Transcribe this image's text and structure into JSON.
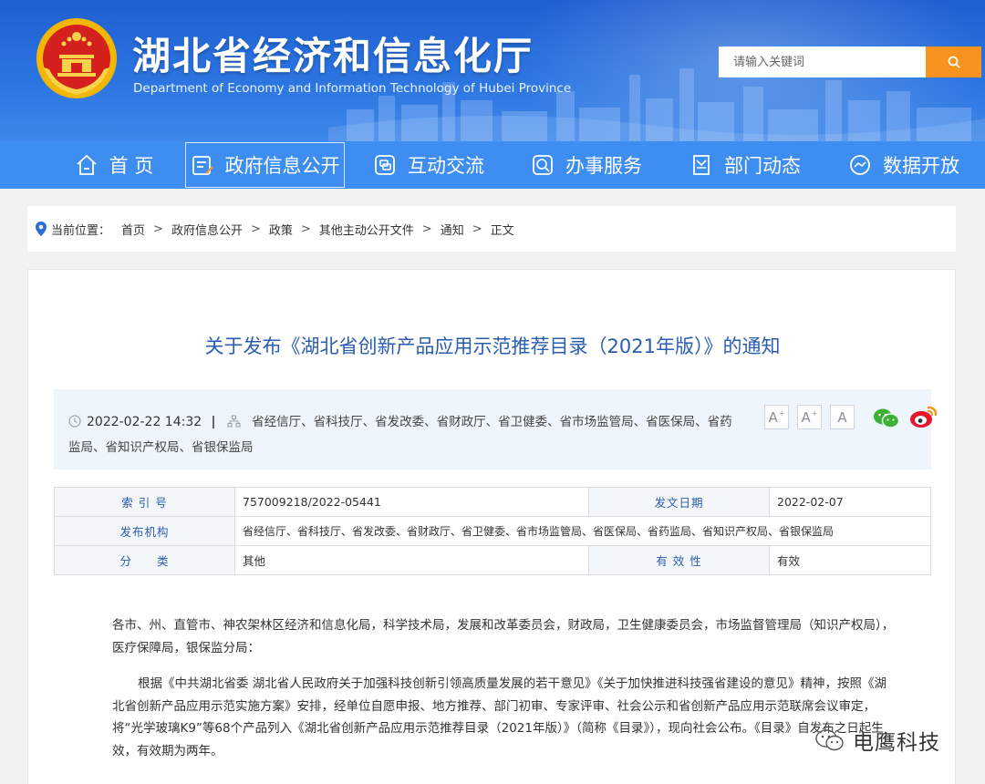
{
  "header": {
    "title": "湖北省经济和信息化厅",
    "subtitle": "Department of Economy and Information Technology of Hubei Province",
    "search_placeholder": "请输入关键词"
  },
  "nav": {
    "items": [
      {
        "label": "首 页",
        "icon": "home-icon"
      },
      {
        "label": "政府信息公开",
        "icon": "document-icon",
        "active": true
      },
      {
        "label": "互动交流",
        "icon": "interaction-icon"
      },
      {
        "label": "办事服务",
        "icon": "service-icon"
      },
      {
        "label": "部门动态",
        "icon": "news-icon"
      },
      {
        "label": "数据开放",
        "icon": "data-icon"
      }
    ]
  },
  "breadcrumb": {
    "prefix": "当前位置：",
    "items": [
      "首页",
      "政府信息公开",
      "政策",
      "其他主动公开文件",
      "通知",
      "正文"
    ]
  },
  "article": {
    "title": "关于发布《湖北省创新产品应用示范推荐目录（2021年版）》的通知",
    "datetime": "2022-02-22 14:32",
    "issuers": "省经信厅、省科技厅、省发改委、省财政厅、省卫健委、省市场监管局、省医保局、省药监局、省知识产权局、省银保监局",
    "font_sizes": [
      "A+",
      "A",
      "A"
    ]
  },
  "info_table": {
    "index_label": "索 引 号",
    "index_value": "757009218/2022-05441",
    "date_label": "发文日期",
    "date_value": "2022-02-07",
    "org_label": "发布机构",
    "org_value": "省经信厅、省科技厅、省发改委、省财政厅、省卫健委、省市场监管局、省医保局、省药监局、省知识产权局、省银保监局",
    "category_label": "分　　类",
    "category_value": "其他",
    "validity_label": "有 效 性",
    "validity_value": "有效"
  },
  "body": {
    "para1": "各市、州、直管市、神农架林区经济和信息化局，科学技术局，发展和改革委员会，财政局，卫生健康委员会，市场监督管理局（知识产权局），医疗保障局，银保监分局：",
    "para2": "根据《中共湖北省委 湖北省人民政府关于加强科技创新引领高质量发展的若干意见》《关于加快推进科技强省建设的意见》精神，按照《湖北省创新产品应用示范实施方案》安排，经单位自愿申报、地方推荐、部门初审、专家评审、社会公示和省创新产品应用示范联席会议审定，将“光学玻璃K9”等68个产品列入《湖北省创新产品应用示范推荐目录（2021年版）》（简称《目录》），现向社会公布。《目录》自发布之日起生效，有效期为两年。"
  },
  "watermark": {
    "text": "电鹰科技"
  },
  "colors": {
    "header_blue": "#2b74e0",
    "nav_blue": "#3d8ef0",
    "search_orange": "#f7931e",
    "title_blue": "#2a5db0",
    "meta_bg": "#eef5fc"
  }
}
